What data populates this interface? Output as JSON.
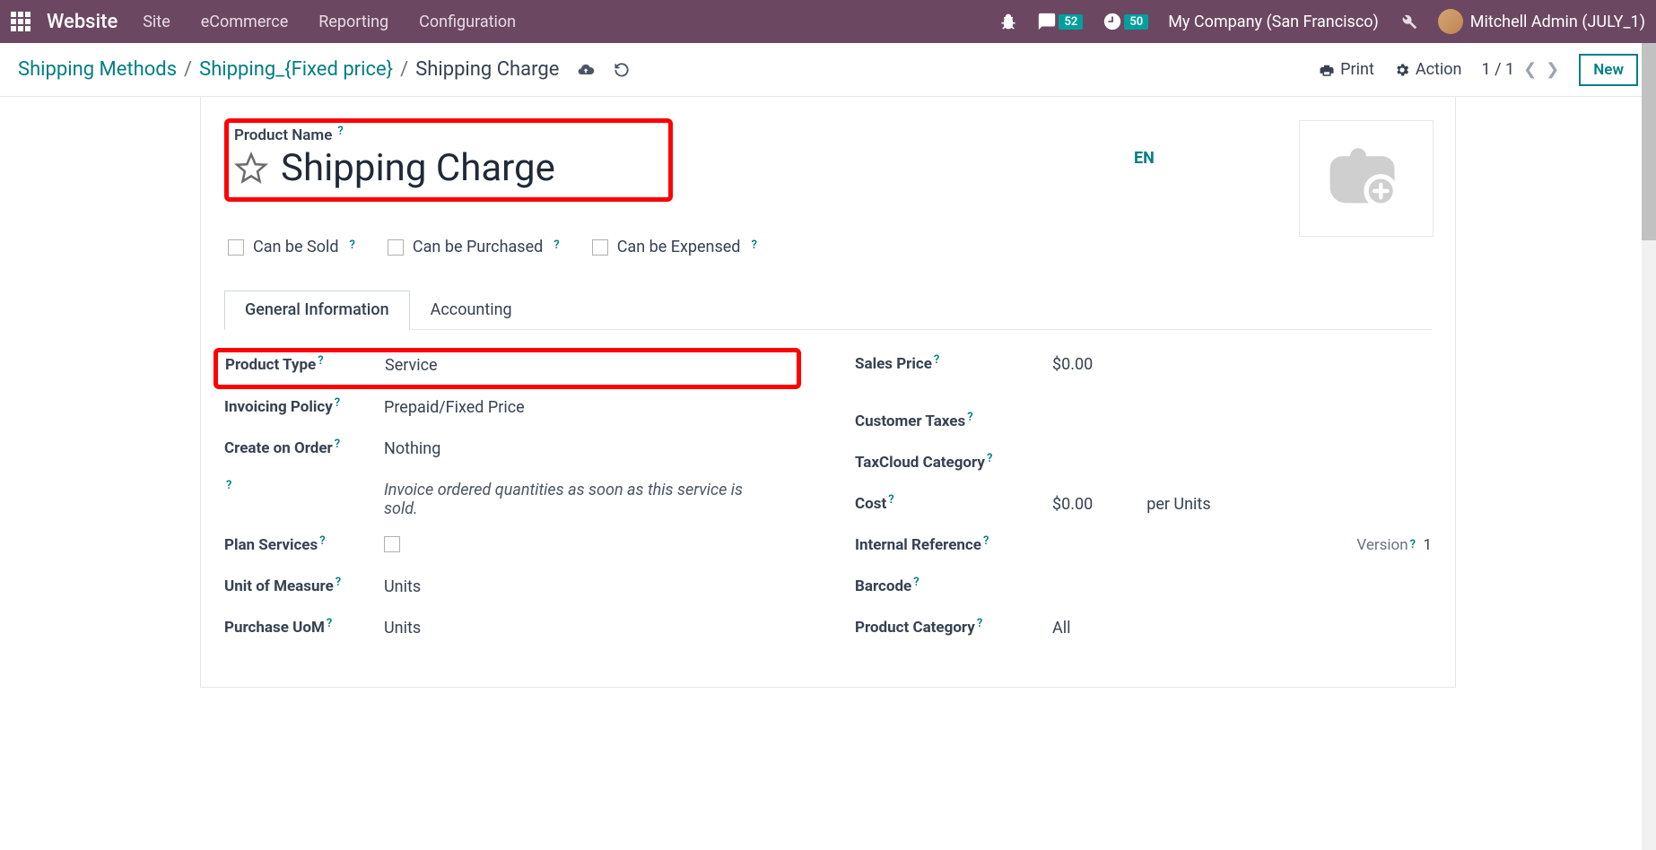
{
  "topnav": {
    "brand": "Website",
    "menu": [
      "Site",
      "eCommerce",
      "Reporting",
      "Configuration"
    ],
    "messages_badge": "52",
    "activities_badge": "50",
    "company": "My Company (San Francisco)",
    "user": "Mitchell Admin (JULY_1)"
  },
  "breadcrumb": {
    "root": "Shipping Methods",
    "mid": "Shipping_{Fixed price}",
    "current": "Shipping Charge"
  },
  "controlbar": {
    "print": "Print",
    "action": "Action",
    "pager": "1 / 1",
    "new": "New"
  },
  "product": {
    "name_label": "Product Name",
    "name": "Shipping Charge",
    "lang": "EN"
  },
  "checks": {
    "sold": "Can be Sold",
    "purchased": "Can be Purchased",
    "expensed": "Can be Expensed"
  },
  "tabs": {
    "general": "General Information",
    "accounting": "Accounting"
  },
  "left_fields": {
    "product_type": {
      "label": "Product Type",
      "value": "Service"
    },
    "invoicing_policy": {
      "label": "Invoicing Policy",
      "value": "Prepaid/Fixed Price"
    },
    "create_on_order": {
      "label": "Create on Order",
      "value": "Nothing"
    },
    "help_text": "Invoice ordered quantities as soon as this service is sold.",
    "plan_services": {
      "label": "Plan Services"
    },
    "uom": {
      "label": "Unit of Measure",
      "value": "Units"
    },
    "purchase_uom": {
      "label": "Purchase UoM",
      "value": "Units"
    }
  },
  "right_fields": {
    "sales_price": {
      "label": "Sales Price",
      "value": "$0.00"
    },
    "customer_taxes": {
      "label": "Customer Taxes"
    },
    "taxcloud": {
      "label": "TaxCloud Category"
    },
    "cost": {
      "label": "Cost",
      "value": "$0.00",
      "per": "per Units"
    },
    "internal_ref": {
      "label": "Internal Reference"
    },
    "version": {
      "label": "Version",
      "value": "1"
    },
    "barcode": {
      "label": "Barcode"
    },
    "category": {
      "label": "Product Category",
      "value": "All"
    }
  }
}
